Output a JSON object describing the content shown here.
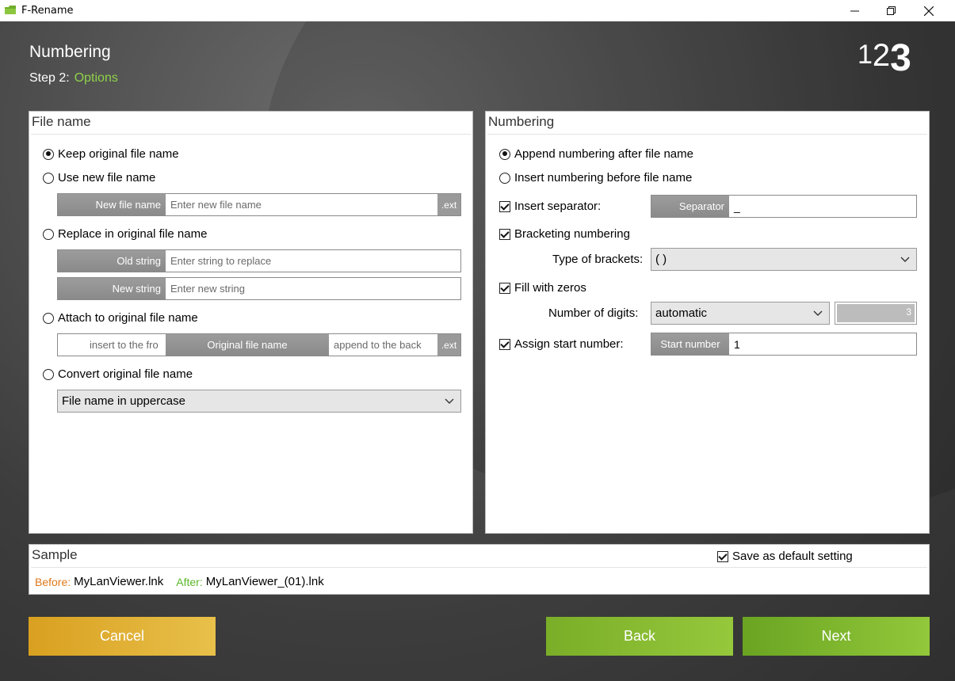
{
  "window": {
    "title": "F-Rename"
  },
  "header": {
    "title": "Numbering",
    "step_label": "Step 2:",
    "step_name": "Options",
    "logo_digits": [
      "1",
      "2",
      "3"
    ]
  },
  "file_name_panel": {
    "title": "File name",
    "keep_original": "Keep original file name",
    "use_new": "Use new file name",
    "new_file_name_label": "New file name",
    "new_file_name_placeholder": "Enter new file name",
    "ext_label": ".ext",
    "replace": "Replace in original file name",
    "old_string_label": "Old string",
    "old_string_placeholder": "Enter string to replace",
    "new_string_label": "New string",
    "new_string_placeholder": "Enter new string",
    "attach": "Attach to original file name",
    "attach_front_placeholder": "insert to the fro",
    "attach_middle_label": "Original file name",
    "attach_back_placeholder": "append to the back",
    "attach_ext_label": ".ext",
    "convert": "Convert original file name",
    "convert_selected": "File name in uppercase",
    "selected_option": "keep_original"
  },
  "numbering_panel": {
    "title": "Numbering",
    "append_after": "Append numbering after file name",
    "insert_before": "Insert numbering before file name",
    "selected_position": "append_after",
    "insert_separator": {
      "label": "Insert separator:",
      "checked": true,
      "field_label": "Separator",
      "value": "_"
    },
    "bracketing": {
      "label": "Bracketing numbering",
      "checked": true,
      "type_label": "Type of brackets:",
      "selected": "( )"
    },
    "fill_zeros": {
      "label": "Fill with zeros",
      "checked": true,
      "digits_label": "Number of digits:",
      "selected": "automatic",
      "digits_value": "3"
    },
    "assign_start": {
      "label": "Assign start number:",
      "checked": true,
      "field_label": "Start number",
      "value": "1"
    }
  },
  "sample_panel": {
    "title": "Sample",
    "save_default": {
      "label": "Save as default setting",
      "checked": true
    },
    "before_label": "Before:",
    "before_value": "MyLanViewer.lnk",
    "after_label": "After:",
    "after_value": "MyLanViewer_(01).lnk"
  },
  "buttons": {
    "cancel": "Cancel",
    "back": "Back",
    "next": "Next"
  },
  "colors": {
    "accent_green": "#8fd24a",
    "cancel": "#e0b030",
    "back": "#88bb30",
    "before_label": "#e0781a",
    "after_label": "#5cb82a"
  }
}
